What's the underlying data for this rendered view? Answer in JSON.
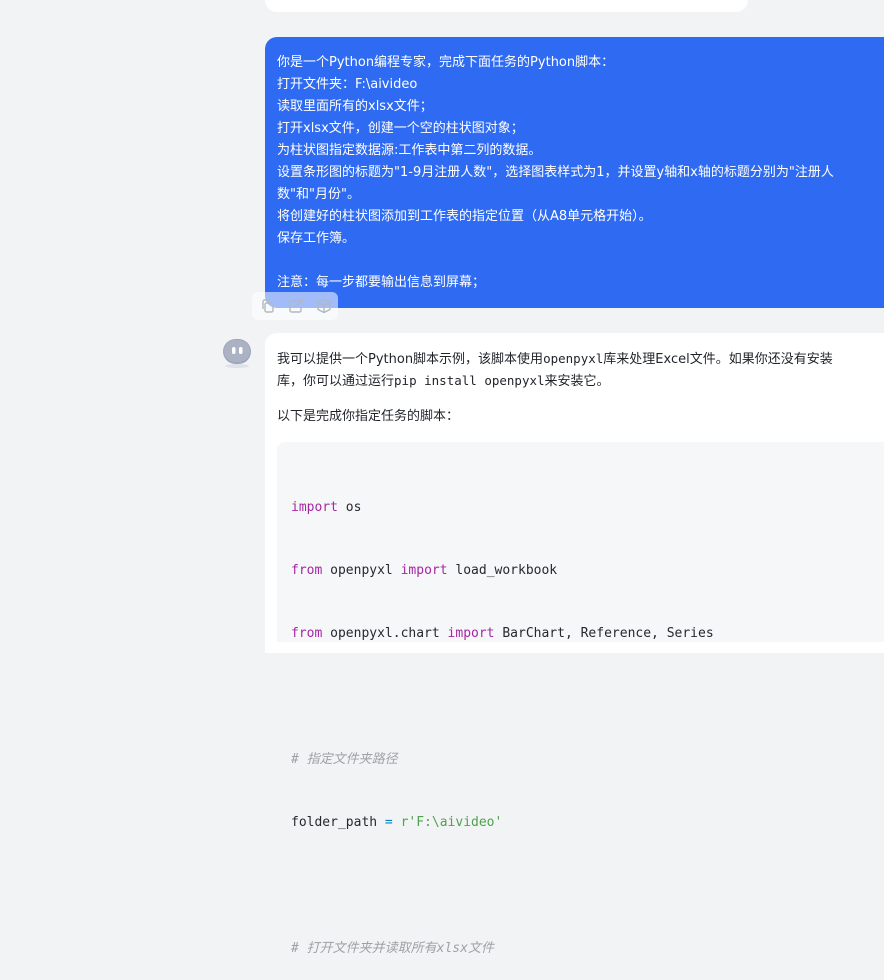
{
  "user_message": {
    "lines": [
      "你是一个Python编程专家，完成下面任务的Python脚本：",
      "打开文件夹：F:\\aivideo",
      "读取里面所有的xlsx文件；",
      "打开xlsx文件，创建一个空的柱状图对象；",
      "为柱状图指定数据源:工作表中第二列的数据。",
      "设置条形图的标题为\"1-9月注册人数\"，选择图表样式为1，并设置y轴和x轴的标题分别为\"注册人",
      "数\"和\"月份\"。",
      "将创建好的柱状图添加到工作表的指定位置（从A8单元格开始）。",
      "保存工作簿。",
      "",
      "注意：每一步都要输出信息到屏幕；"
    ]
  },
  "message_actions": {
    "copy_icon": "copy-icon",
    "share_icon": "share-icon",
    "box_icon": "cube-icon"
  },
  "bot_reply": {
    "para1_a": "我可以提供一个Python脚本示例，该脚本使用",
    "para1_code1": "openpyxl",
    "para1_b": "库来处理Excel文件。如果你还没有安装",
    "para2_a": "库，你可以通过运行",
    "para2_code": "pip install openpyxl",
    "para2_b": "来安装它。",
    "para3": "以下是完成你指定任务的脚本：",
    "code": {
      "l1_kw": "import",
      "l1_rest": " os",
      "l2_kw1": "from",
      "l2_mid": " openpyxl ",
      "l2_kw2": "import",
      "l2_rest": " load_workbook",
      "l3_kw1": "from",
      "l3_mid": " openpyxl.chart ",
      "l3_kw2": "import",
      "l3_rest": " BarChart, Reference, Series",
      "l5_comment": "# 指定文件夹路径",
      "l6_var": "folder_path ",
      "l6_op": "=",
      "l6_str": " r'F:\\aivideo'",
      "l8_comment": "# 打开文件夹并读取所有xlsx文件"
    }
  },
  "colors": {
    "user_bubble": "#2f6bf2",
    "background": "#f2f3f5",
    "keyword": "#a626a4",
    "string": "#50a14f",
    "comment": "#a0a1a7"
  }
}
